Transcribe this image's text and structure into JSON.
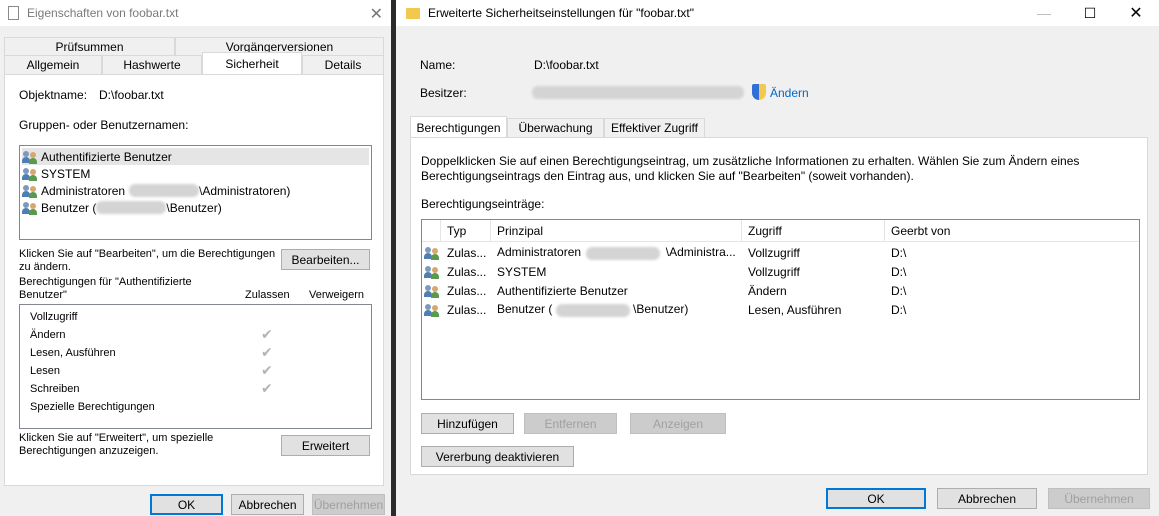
{
  "left_window": {
    "title": "Eigenschaften von foobar.txt",
    "tabs_row1": [
      "Prüfsummen",
      "Vorgängerversionen"
    ],
    "tabs_row2": [
      "Allgemein",
      "Hashwerte",
      "Sicherheit",
      "Details"
    ],
    "object_label": "Objektname:",
    "object_value": "D:\\foobar.txt",
    "groups_label": "Gruppen- oder Benutzernamen:",
    "groups": [
      {
        "name": "Authentifizierte Benutzer",
        "suffix": ""
      },
      {
        "name": "SYSTEM",
        "suffix": ""
      },
      {
        "name": "Administratoren",
        "suffix": "\\Administratoren)"
      },
      {
        "name": "Benutzer (",
        "suffix": "\\Benutzer)"
      }
    ],
    "edit_hint": "Klicken Sie auf \"Bearbeiten\", um die Berechtigungen zu ändern.",
    "edit_button": "Bearbeiten...",
    "perm_for_label": "Berechtigungen für \"Authentifizierte Benutzer\"",
    "col_allow": "Zulassen",
    "col_deny": "Verweigern",
    "permissions": [
      {
        "name": "Vollzugriff",
        "allow": false
      },
      {
        "name": "Ändern",
        "allow": true
      },
      {
        "name": "Lesen, Ausführen",
        "allow": true
      },
      {
        "name": "Lesen",
        "allow": true
      },
      {
        "name": "Schreiben",
        "allow": true
      },
      {
        "name": "Spezielle Berechtigungen",
        "allow": false
      }
    ],
    "advanced_hint": "Klicken Sie auf \"Erweitert\", um spezielle Berechtigungen anzuzeigen.",
    "advanced_button": "Erweitert",
    "ok": "OK",
    "cancel": "Abbrechen",
    "apply": "Übernehmen"
  },
  "right_window": {
    "title": "Erweiterte Sicherheitseinstellungen für \"foobar.txt\"",
    "name_label": "Name:",
    "name_value": "D:\\foobar.txt",
    "owner_label": "Besitzer:",
    "change_link": "Ändern",
    "tabs": [
      "Berechtigungen",
      "Überwachung",
      "Effektiver Zugriff"
    ],
    "info_text": "Doppelklicken Sie auf einen Berechtigungseintrag, um zusätzliche Informationen zu erhalten. Wählen Sie zum Ändern eines Berechtigungseintrags den Eintrag aus, und klicken Sie auf \"Bearbeiten\" (soweit vorhanden).",
    "entries_label": "Berechtigungseinträge:",
    "columns": [
      "Typ",
      "Prinzipal",
      "Zugriff",
      "Geerbt von"
    ],
    "entries": [
      {
        "type": "Zulas...",
        "principal": "Administratoren",
        "principal_suffix": "\\Administra...",
        "access": "Vollzugriff",
        "inherited": "D:\\"
      },
      {
        "type": "Zulas...",
        "principal": "SYSTEM",
        "principal_suffix": "",
        "access": "Vollzugriff",
        "inherited": "D:\\"
      },
      {
        "type": "Zulas...",
        "principal": "Authentifizierte Benutzer",
        "principal_suffix": "",
        "access": "Ändern",
        "inherited": "D:\\"
      },
      {
        "type": "Zulas...",
        "principal": "Benutzer (",
        "principal_suffix": "\\Benutzer)",
        "access": "Lesen, Ausführen",
        "inherited": "D:\\"
      }
    ],
    "add_button": "Hinzufügen",
    "remove_button": "Entfernen",
    "view_button": "Anzeigen",
    "disable_inheritance_button": "Vererbung deaktivieren",
    "ok": "OK",
    "cancel": "Abbrechen",
    "apply": "Übernehmen"
  }
}
